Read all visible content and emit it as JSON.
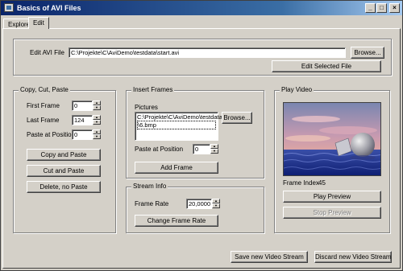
{
  "window": {
    "title": "Basics of AVI Files",
    "controls": {
      "minimize": "_",
      "maximize": "□",
      "close": "×"
    }
  },
  "tabs": [
    {
      "label": "Explore"
    },
    {
      "label": "Edit"
    }
  ],
  "edit_file": {
    "label": "Edit AVI File",
    "path": "C:\\Projekte\\C\\AviDemo\\testdata\\start.avi",
    "browse": "Browse...",
    "edit_selected": "Edit Selected File"
  },
  "copy_group": {
    "title": "Copy, Cut, Paste",
    "first_frame_label": "First Frame",
    "first_frame": "0",
    "last_frame_label": "Last Frame",
    "last_frame": "124",
    "paste_pos_label": "Paste at Position",
    "paste_pos": "0",
    "copy_paste": "Copy and Paste",
    "cut_paste": "Cut and Paste",
    "delete_no_paste": "Delete, no Paste"
  },
  "insert_group": {
    "title": "Insert Frames",
    "pictures_label": "Pictures",
    "pictures": [
      "C:\\Projekte\\C\\AviDemo\\testdata",
      "\\6.bmp"
    ],
    "browse": "Browse...",
    "paste_pos_label": "Paste at Position",
    "paste_pos": "0",
    "add_frame": "Add Frame"
  },
  "stream_group": {
    "title": "Stream Info",
    "frame_rate_label": "Frame Rate",
    "frame_rate": "20,0000",
    "change_rate": "Change Frame Rate"
  },
  "play_group": {
    "title": "Play Video",
    "frame_index_label": "Frame Index",
    "frame_index": "45",
    "play_preview": "Play Preview",
    "stop_preview": "Stop Preview"
  },
  "footer": {
    "save_stream": "Save new Video Stream",
    "discard_stream": "Discard new Video Stream"
  },
  "colors": {
    "title_start": "#0a246a",
    "title_end": "#a6caf0",
    "face": "#d4d0c8"
  }
}
